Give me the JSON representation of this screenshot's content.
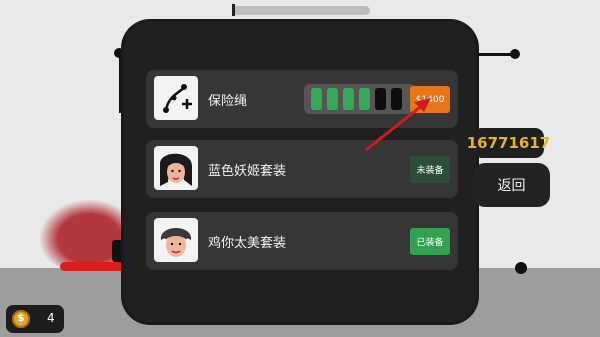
{
  "upgrades": [
    {
      "label": "保险绳",
      "icon": "rope-plus-icon",
      "level_filled": 4,
      "level_total": 6,
      "price_label": "$1400",
      "price_color": "#e5761a"
    },
    {
      "label": "蓝色妖姬套装",
      "icon": "blue-enchantress-face",
      "status_label": "未装备",
      "status_color": "#2d4f39"
    },
    {
      "label": "鸡你太美套装",
      "icon": "jntm-face",
      "status_label": "已装备",
      "status_color": "#32a252"
    }
  ],
  "score": "16771617",
  "back_label": "返回",
  "coins": "4",
  "colors": {
    "panel": "#202020",
    "row": "#363636",
    "score_text": "#e8b421",
    "arrow": "#d01c1c"
  }
}
